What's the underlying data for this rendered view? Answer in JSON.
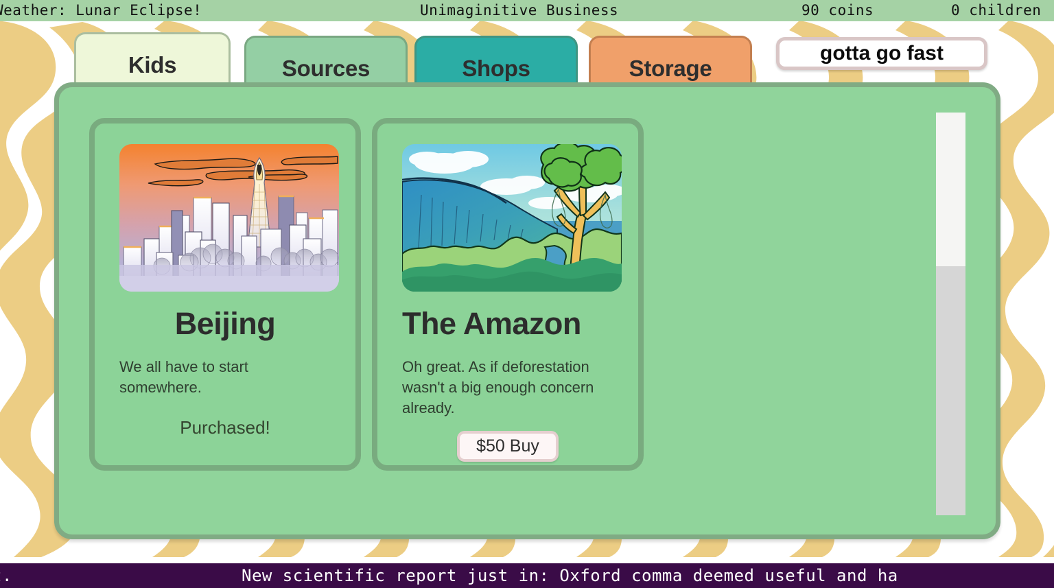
{
  "theme": {
    "background_tan": "#eccd84",
    "background_white": "#ffffff",
    "topbar_green": "#a5d2a5",
    "panel_green": "#90d49b",
    "panel_border": "#80ab84",
    "card_green": "#8cd398",
    "card_border": "#79ab7f",
    "ticker_purple": "#3a0b47",
    "tab_kids": "#eef7d9",
    "tab_sources": "#94cfa4",
    "tab_shops": "#2bada5",
    "tab_storage": "#f0a06a",
    "button_white": "#ffffff",
    "button_border": "#d9c6c6"
  },
  "topbar": {
    "weather": "Weather: Lunar Eclipse!",
    "business_name": "Unimaginitive Business",
    "coins": "90 coins",
    "children": "0 children"
  },
  "tabs": [
    {
      "id": "kids",
      "label": "Kids",
      "active": true
    },
    {
      "id": "sources",
      "label": "Sources",
      "active": false
    },
    {
      "id": "shops",
      "label": "Shops",
      "active": false
    },
    {
      "id": "storage",
      "label": "Storage",
      "active": false
    }
  ],
  "fast_button": {
    "label": "gotta go fast"
  },
  "cards": [
    {
      "id": "beijing",
      "title": "Beijing",
      "description": "We all have to start somewhere.",
      "art": "city-skyline-sunset",
      "status": "Purchased!",
      "purchased": true,
      "price": null,
      "buy_label": null
    },
    {
      "id": "the-amazon",
      "title": "The Amazon",
      "description": "Oh great. As if deforestation wasn't a big enough concern already.",
      "art": "rainforest-waterfall",
      "status": null,
      "purchased": false,
      "price": "$50",
      "buy_label": "$50 Buy"
    }
  ],
  "scrollbar": {
    "thumb_position": "top",
    "thumb_fraction": 0.38
  },
  "ticker": {
    "left_fragment": "t.",
    "headline": "New scientific report just in: Oxford comma deemed useful and ha"
  },
  "icons": {
    "scrollbar_thumb": "scrollbar-thumb",
    "beijing_art": "city-skyline-icon",
    "amazon_art": "rainforest-icon"
  }
}
